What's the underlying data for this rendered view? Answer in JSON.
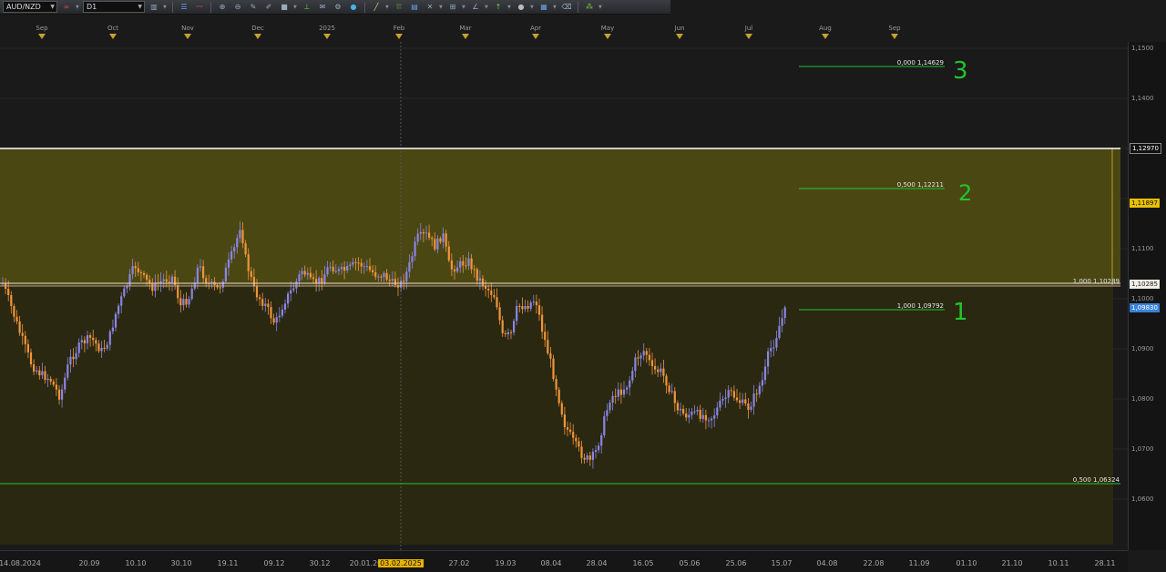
{
  "toolbar": {
    "symbol": "AUD/NZD",
    "timeframe": "D1",
    "icons": [
      "chart-type-icon",
      "templates-icon",
      "indicators-icon",
      "zoom-in-icon",
      "zoom-out-icon",
      "pencil-icon",
      "drawing-tools-icon",
      "trend-line-icon",
      "text-icon",
      "shapes-icon",
      "magnet-icon",
      "fibonacci-icon",
      "channel-icon",
      "rectangle-icon",
      "crosshair-icon",
      "pitchfork-icon",
      "circle-icon",
      "eraser-icon",
      "alerts-icon"
    ]
  },
  "top_axis": {
    "labels": [
      "Sep",
      "Oct",
      "Nov",
      "Dec",
      "2025",
      "Feb",
      "Mar",
      "Apr",
      "May",
      "Jun",
      "Jul",
      "Aug",
      "Sep"
    ]
  },
  "price_axis": {
    "ticks": [
      "1,1500",
      "1,1400",
      "1,1100",
      "1,1000",
      "1,0900",
      "1,0800",
      "1,0700",
      "1,0600"
    ],
    "tags": {
      "upper_zone": "1,12970",
      "current_hi": "1,11897",
      "mid_zone": "1,10285",
      "bid": "1,09830"
    }
  },
  "fib_levels": [
    {
      "label": "0,000 1,14629"
    },
    {
      "label": "0,500 1,12211"
    },
    {
      "label": "1,000 1,09792"
    },
    {
      "label": "1,000 1,10289"
    },
    {
      "label": "0,500 1,06324"
    }
  ],
  "annotations": [
    "3",
    "2",
    "1"
  ],
  "bottom_axis": {
    "labels": [
      "14.08.2024",
      "20.09",
      "10.10",
      "30.10",
      "19.11",
      "09.12",
      "30.12",
      "20.01.202",
      "03.02.2025",
      "27.02",
      "19.03",
      "08.04",
      "28.04",
      "16.05",
      "05.06",
      "25.06",
      "15.07",
      "04.08",
      "22.08",
      "11.09",
      "01.10",
      "21.10",
      "10.11",
      "28.11"
    ],
    "active": "03.02.2025"
  },
  "colors": {
    "bull": "#8a85e6",
    "bear": "#f0943a",
    "zone_upper": "#4a4712",
    "zone_lower": "#2a2810",
    "fib_green": "#22c42e",
    "white_line": "#ffffff"
  }
}
